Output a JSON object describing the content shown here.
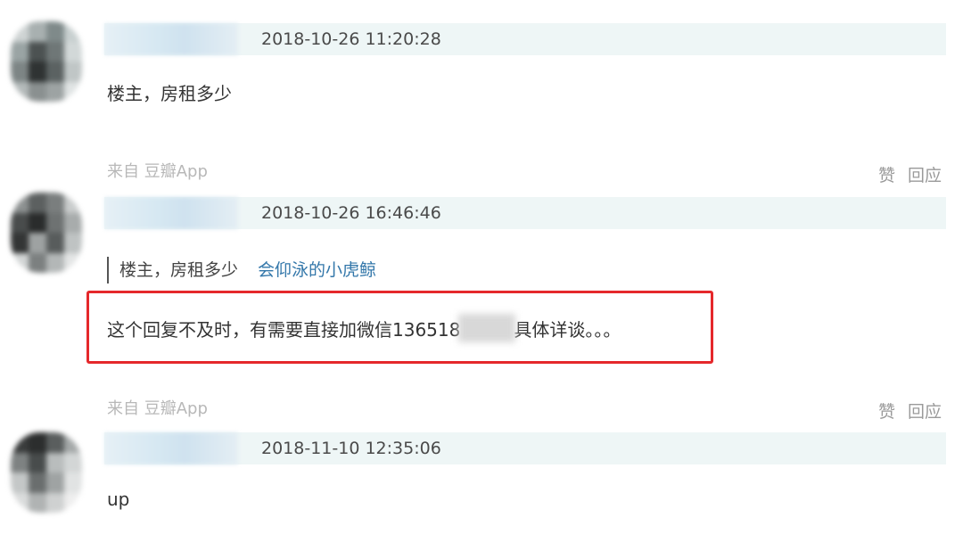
{
  "comments": [
    {
      "timestamp": "2018-10-26 11:20:28",
      "text": "楼主，房租多少",
      "source": "来自 豆瓣App",
      "actions": [
        "赞",
        "回应"
      ]
    },
    {
      "timestamp": "2018-10-26 16:46:46",
      "quote": {
        "text": "楼主，房租多少",
        "author": "会仰泳的小虎鲸"
      },
      "reply_prefix": "这个回复不及时，有需要直接加微信",
      "reply_number_visible": "136518",
      "reply_suffix": "具体详谈。。。",
      "source": "来自 豆瓣App",
      "actions": [
        "赞",
        "回应"
      ],
      "highlight_color": "#e5282b"
    },
    {
      "timestamp": "2018-11-10 12:35:06",
      "text": "up"
    }
  ],
  "colors": {
    "link": "#3377aa",
    "header_bg": "#eef6f6",
    "muted": "#b8b8b8"
  }
}
